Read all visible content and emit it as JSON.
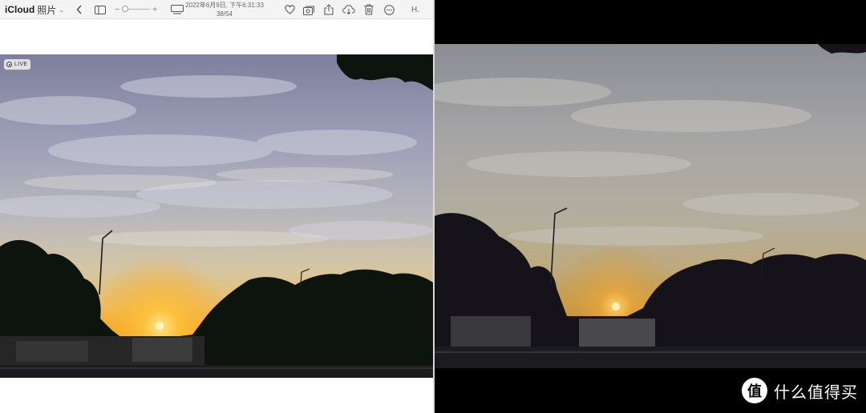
{
  "toolbar": {
    "app_name": "iCloud",
    "section": "照片",
    "zoom_minus": "−",
    "zoom_plus": "+",
    "date": "2022年6月9日, 下午6:31:33",
    "counter": "38/54",
    "user_initial": "H."
  },
  "photo": {
    "live_label": "LIVE"
  },
  "watermark": {
    "logo": "值",
    "text": "什么值得买"
  },
  "icons": [
    "chevron-down-icon",
    "back-icon",
    "sidebar-icon",
    "zoom-slider",
    "slideshow-icon",
    "heart-icon",
    "add-to-album-icon",
    "share-icon",
    "download-icon",
    "trash-icon",
    "more-icon",
    "live-photo-icon"
  ],
  "colors": {
    "toolbar_bg": "#f4f4f4",
    "sky_left": "#8f8fa8",
    "sunset": "#f2a01e"
  }
}
